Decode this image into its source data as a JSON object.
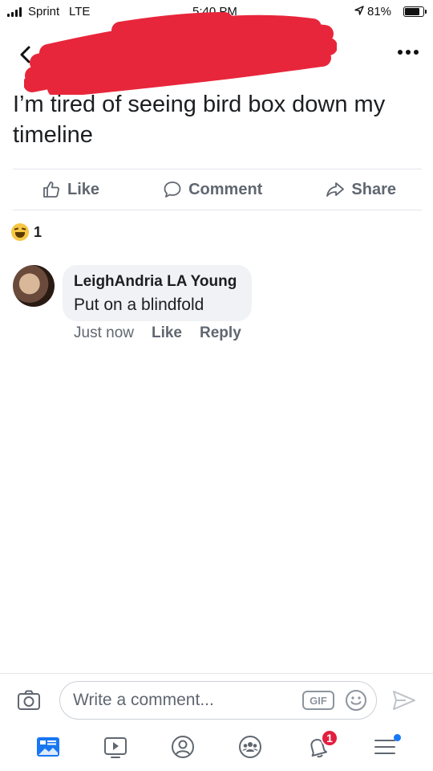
{
  "status_bar": {
    "carrier": "Sprint",
    "network": "LTE",
    "time": "5:40 PM",
    "battery": "81%",
    "battery_level": 0.81,
    "icons": [
      "signal-icon",
      "location-arrow-icon",
      "battery-icon"
    ]
  },
  "header": {
    "icons": [
      "back-chevron-icon",
      "more-dots-icon"
    ]
  },
  "post": {
    "text": "I’m tired of seeing bird box down my timeline",
    "actions": [
      {
        "label": "Like",
        "icon": "thumbs-up-icon"
      },
      {
        "label": "Comment",
        "icon": "comment-bubble-icon"
      },
      {
        "label": "Share",
        "icon": "share-arrow-icon"
      }
    ],
    "reaction_icon": "haha-emoji-icon",
    "reaction_count": "1"
  },
  "comment": {
    "author": "LeighAndria LA Young",
    "text": "Put on a blindfold",
    "time": "Just now",
    "like_label": "Like",
    "reply_label": "Reply"
  },
  "composer": {
    "placeholder": "Write a comment...",
    "gif_label": "GIF",
    "icons": [
      "camera-icon",
      "emoji-icon",
      "send-icon"
    ]
  },
  "tab_bar": {
    "tabs": [
      "news-feed-icon",
      "watch-icon",
      "profile-icon",
      "groups-icon",
      "notifications-icon",
      "menu-icon"
    ],
    "notifications_badge": "1"
  },
  "colors": {
    "redaction": "#e8263b",
    "accent": "#1877f2",
    "badge": "#e41e3f",
    "secondary_text": "#606770"
  }
}
